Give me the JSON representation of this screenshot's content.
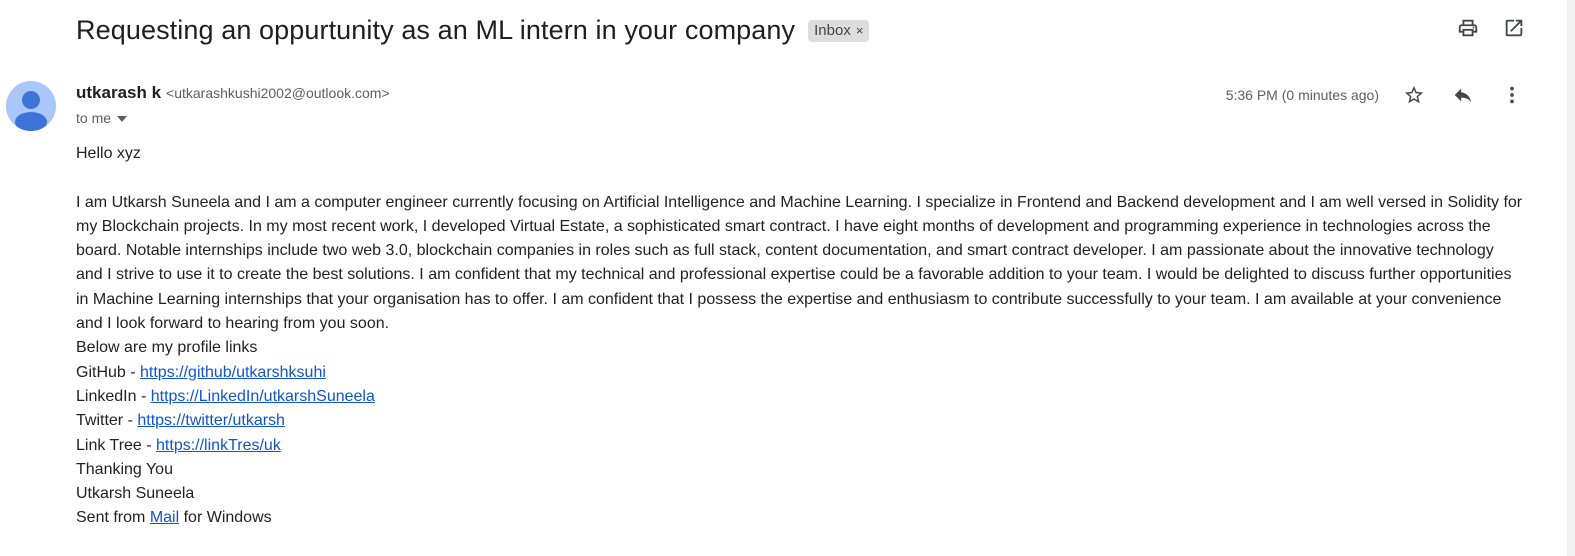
{
  "email": {
    "subject": "Requesting an oppurtunity as an ML intern in your company",
    "label": "Inbox",
    "label_remove": "×",
    "sender_name": "utkarash k",
    "sender_email": "<utkarashkushi2002@outlook.com>",
    "recipient": "to me",
    "timestamp": "5:36 PM (0 minutes ago)",
    "greeting": "Hello xyz",
    "paragraph": "I am Utkarsh Suneela and I am a computer engineer currently focusing on Artificial Intelligence and Machine Learning. I specialize in Frontend and Backend development and I am well versed in Solidity for my Blockchain projects. In my most recent work, I developed Virtual Estate, a sophisticated smart contract. I have eight months of development and programming experience in technologies across the board. Notable internships include two web 3.0, blockchain companies in roles such as full stack, content documentation, and smart contract developer. I am passionate about the innovative technology and I strive to use it to create the best solutions. I am confident that my technical and professional expertise could be a favorable addition to your team. I would be delighted to discuss further opportunities in Machine Learning internships that your organisation has to offer. I am confident that I possess the expertise and enthusiasm to contribute successfully to your team. I am available at your convenience and I look forward to hearing from you soon.",
    "links_intro": "Below are my profile links",
    "links": [
      {
        "label": "GitHub - ",
        "url": "https://github/utkarshksuhi"
      },
      {
        "label": "LinkedIn - ",
        "url": "https://LinkedIn/utkarshSuneela"
      },
      {
        "label": "Twitter - ",
        "url": "https://twitter/utkarsh"
      },
      {
        "label": "Link Tree - ",
        "url": "https://linkTres/uk"
      }
    ],
    "closing": "Thanking You",
    "signature": "Utkarsh Suneela",
    "sent_prefix": "Sent from ",
    "sent_link": "Mail",
    "sent_suffix": " for Windows"
  },
  "icons": {
    "print": "print-icon",
    "open_new_window": "open-in-new-icon",
    "star": "star-icon",
    "reply": "reply-icon",
    "more": "more-vert-icon",
    "avatar": "person-avatar-icon"
  },
  "colors": {
    "link": "#1155cc",
    "avatar_bg": "#a9c7fa",
    "avatar_fg": "#3e74d8",
    "label_chip_bg": "#dddddd"
  }
}
